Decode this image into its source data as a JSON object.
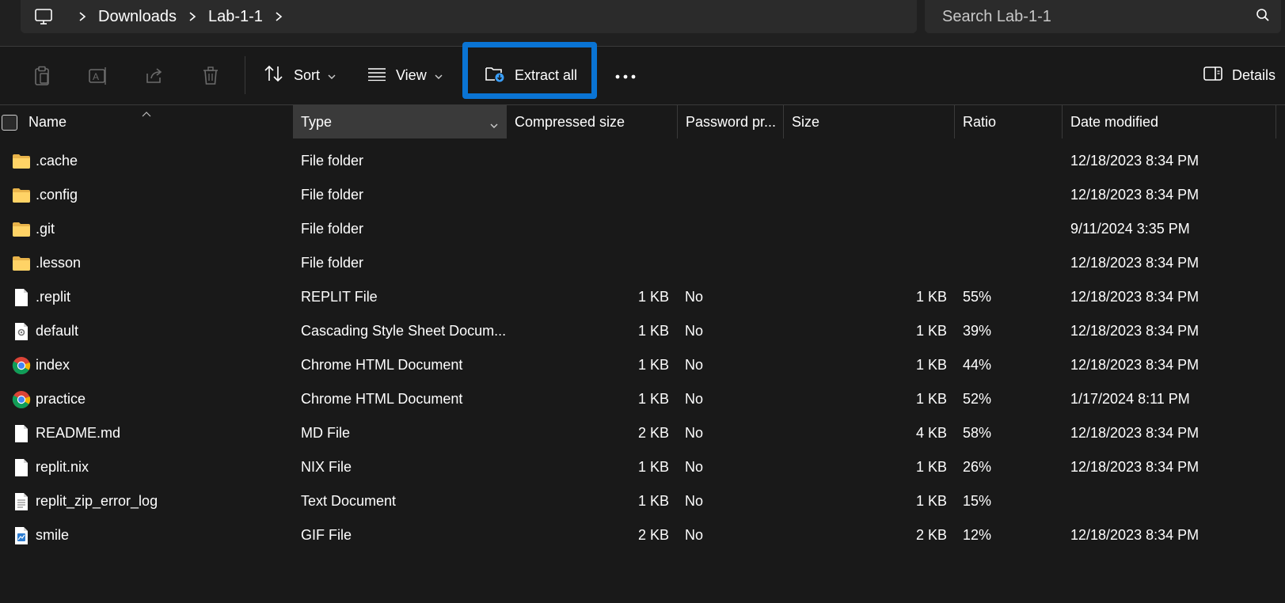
{
  "breadcrumb": {
    "items": [
      "Downloads",
      "Lab-1-1"
    ]
  },
  "search": {
    "placeholder": "Search Lab-1-1"
  },
  "toolbar": {
    "sort_label": "Sort",
    "view_label": "View",
    "extract_label": "Extract all",
    "details_label": "Details",
    "highlight_color": "#0a74d4"
  },
  "columns": {
    "name": "Name",
    "type": "Type",
    "compressed_size": "Compressed size",
    "password": "Password pr...",
    "size": "Size",
    "ratio": "Ratio",
    "date_modified": "Date modified"
  },
  "files": [
    {
      "icon": "folder-icon",
      "name": ".cache",
      "type": "File folder",
      "compressed": "",
      "password": "",
      "size": "",
      "ratio": "",
      "date": "12/18/2023 8:34 PM"
    },
    {
      "icon": "folder-icon",
      "name": ".config",
      "type": "File folder",
      "compressed": "",
      "password": "",
      "size": "",
      "ratio": "",
      "date": "12/18/2023 8:34 PM"
    },
    {
      "icon": "folder-icon",
      "name": ".git",
      "type": "File folder",
      "compressed": "",
      "password": "",
      "size": "",
      "ratio": "",
      "date": "9/11/2024 3:35 PM"
    },
    {
      "icon": "folder-icon",
      "name": ".lesson",
      "type": "File folder",
      "compressed": "",
      "password": "",
      "size": "",
      "ratio": "",
      "date": "12/18/2023 8:34 PM"
    },
    {
      "icon": "file-icon",
      "name": ".replit",
      "type": "REPLIT File",
      "compressed": "1 KB",
      "password": "No",
      "size": "1 KB",
      "ratio": "55%",
      "date": "12/18/2023 8:34 PM"
    },
    {
      "icon": "css-file-icon",
      "name": "default",
      "type": "Cascading Style Sheet Docum...",
      "compressed": "1 KB",
      "password": "No",
      "size": "1 KB",
      "ratio": "39%",
      "date": "12/18/2023 8:34 PM"
    },
    {
      "icon": "chrome-icon",
      "name": "index",
      "type": "Chrome HTML Document",
      "compressed": "1 KB",
      "password": "No",
      "size": "1 KB",
      "ratio": "44%",
      "date": "12/18/2023 8:34 PM"
    },
    {
      "icon": "chrome-icon",
      "name": "practice",
      "type": "Chrome HTML Document",
      "compressed": "1 KB",
      "password": "No",
      "size": "1 KB",
      "ratio": "52%",
      "date": "1/17/2024 8:11 PM"
    },
    {
      "icon": "file-icon",
      "name": "README.md",
      "type": "MD File",
      "compressed": "2 KB",
      "password": "No",
      "size": "4 KB",
      "ratio": "58%",
      "date": "12/18/2023 8:34 PM"
    },
    {
      "icon": "file-icon",
      "name": "replit.nix",
      "type": "NIX File",
      "compressed": "1 KB",
      "password": "No",
      "size": "1 KB",
      "ratio": "26%",
      "date": "12/18/2023 8:34 PM"
    },
    {
      "icon": "text-file-icon",
      "name": "replit_zip_error_log",
      "type": "Text Document",
      "compressed": "1 KB",
      "password": "No",
      "size": "1 KB",
      "ratio": "15%",
      "date": ""
    },
    {
      "icon": "image-file-icon",
      "name": "smile",
      "type": "GIF File",
      "compressed": "2 KB",
      "password": "No",
      "size": "2 KB",
      "ratio": "12%",
      "date": "12/18/2023 8:34 PM"
    }
  ]
}
